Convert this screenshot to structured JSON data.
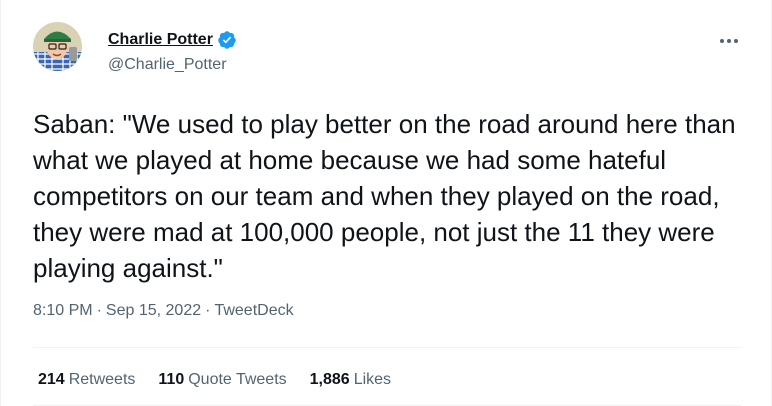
{
  "author": {
    "display_name": "Charlie Potter",
    "handle": "@Charlie_Potter",
    "verified": true,
    "verified_color": "#1d9bf0"
  },
  "tweet": {
    "text": "Saban: \"We used to play better on the road around here than what we played at home because we had some hateful competitors on our team and when they played on the road, they were mad at 100,000 people, not just the 11 they were playing against.\""
  },
  "meta": {
    "time": "8:10 PM",
    "separator": "·",
    "date": "Sep 15, 2022",
    "source": "TweetDeck"
  },
  "stats": {
    "retweets_count": "214",
    "retweets_label": "Retweets",
    "quotes_count": "110",
    "quotes_label": "Quote Tweets",
    "likes_count": "1,886",
    "likes_label": "Likes"
  },
  "icons": {
    "more": "more-options-icon",
    "verified": "verified-badge-icon"
  }
}
